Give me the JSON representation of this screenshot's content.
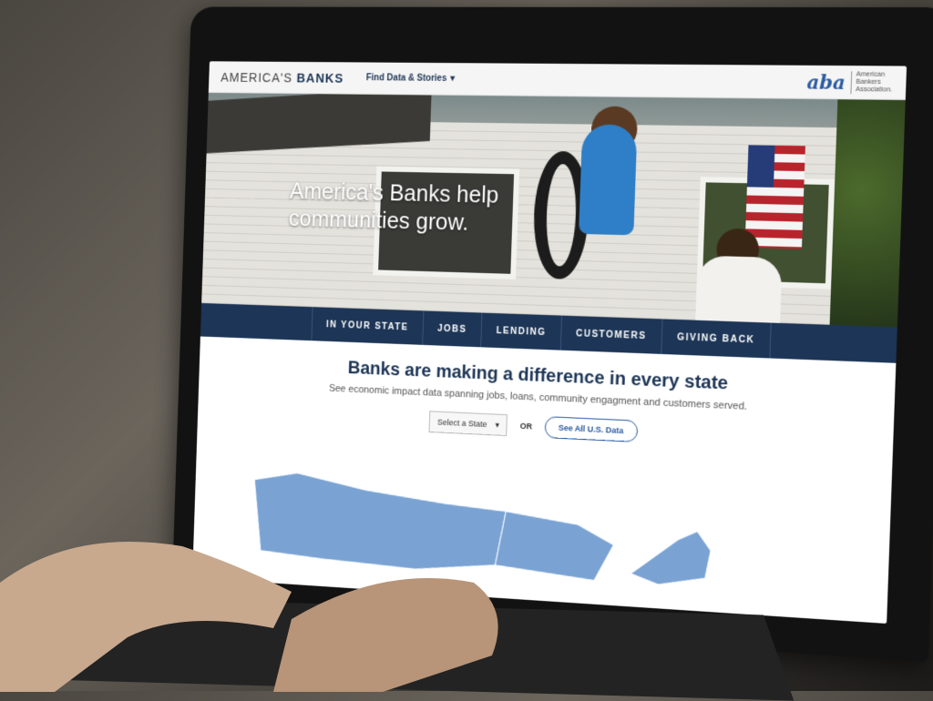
{
  "header": {
    "brand_prefix": "AMERICA'S",
    "brand_suffix": "BANKS",
    "find_data_label": "Find Data & Stories",
    "aba_mark": "aba",
    "aba_text_line1": "American",
    "aba_text_line2": "Bankers",
    "aba_text_line3": "Association."
  },
  "hero": {
    "headline": "America's Banks help communities grow."
  },
  "nav": {
    "items": [
      {
        "label": "IN YOUR STATE"
      },
      {
        "label": "JOBS"
      },
      {
        "label": "LENDING"
      },
      {
        "label": "CUSTOMERS"
      },
      {
        "label": "GIVING BACK"
      }
    ]
  },
  "content": {
    "headline": "Banks are making a difference in every state",
    "subhead": "See economic impact data spanning jobs, loans, community engagment and customers served.",
    "select_label": "Select a State",
    "or_label": "OR",
    "see_all_label": "See All U.S. Data"
  },
  "colors": {
    "navy": "#1d3556",
    "accent_blue": "#2a5aa0",
    "map_blue": "#7aa3d4"
  }
}
